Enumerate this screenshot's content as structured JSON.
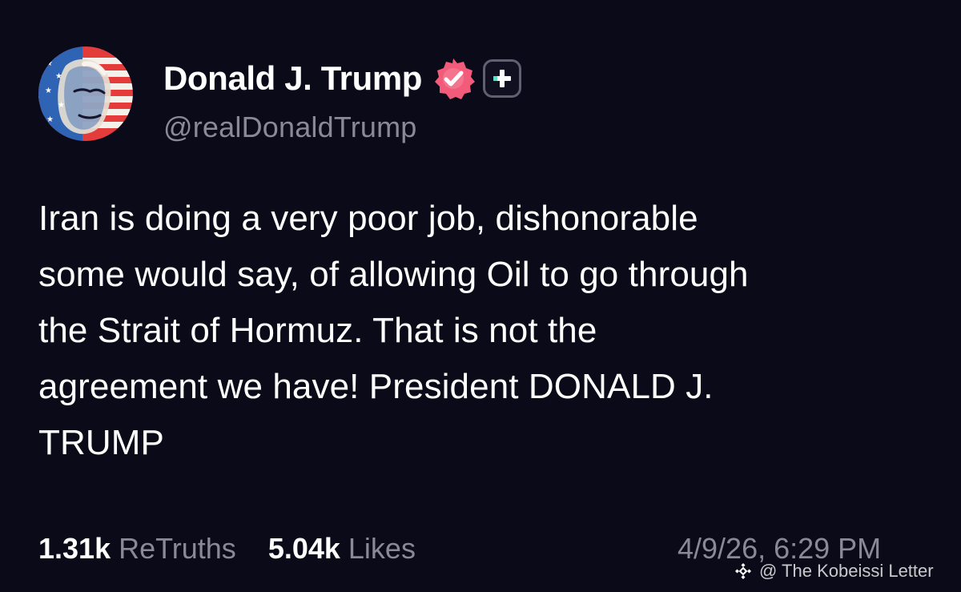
{
  "profile": {
    "display_name": "Donald J. Trump",
    "handle": "@realDonaldTrump",
    "avatar_icon": "flag-face-avatar",
    "verified_icon": "verified-badge-icon",
    "plus_icon": "plus-badge-icon",
    "colors": {
      "verified_badge": "#f25c7a",
      "plus_badge_accent": "#5ee1c6",
      "handle": "#8a8a96"
    }
  },
  "post": {
    "lines": [
      "Iran is doing a very poor job, dishonorable",
      "some would say, of allowing Oil to go through",
      "the Strait of Hormuz. That is not the",
      "agreement we have! President DONALD J.",
      "TRUMP"
    ]
  },
  "stats": {
    "retruths_count": "1.31k",
    "retruths_label": "ReTruths",
    "likes_count": "5.04k",
    "likes_label": "Likes"
  },
  "timestamp": "4/9/26, 6:29 PM",
  "watermark": {
    "text": "@ The Kobeissi Letter",
    "icon": "diamond-logo-icon"
  },
  "theme": {
    "background": "#0b0a19",
    "primary_text": "#ffffff",
    "secondary_text": "#8a8a96"
  }
}
